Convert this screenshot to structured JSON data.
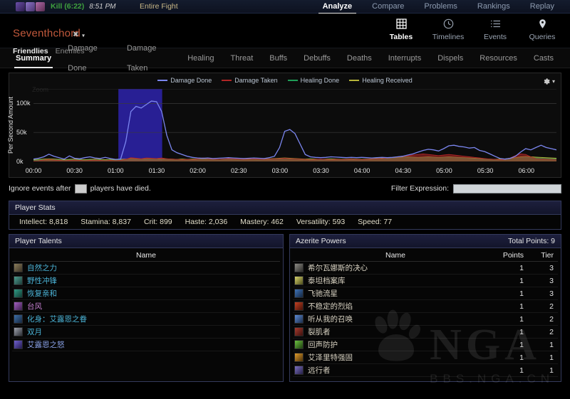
{
  "topbar": {
    "kill_label": "Kill (6:22)",
    "kill_time": "8:51 PM",
    "scope_label": "Entire Fight",
    "nav": [
      {
        "label": "Analyze",
        "selected": true
      },
      {
        "label": "Compare",
        "selected": false
      },
      {
        "label": "Problems",
        "selected": false
      },
      {
        "label": "Rankings",
        "selected": false
      },
      {
        "label": "Replay",
        "selected": false
      }
    ]
  },
  "player": {
    "name": "Seventhchord",
    "close_glyph": "✖",
    "caret_glyph": "▾",
    "friendlies_label": "Friendlies",
    "enemies_label": "Enemies"
  },
  "viewnav": [
    {
      "label": "Tables",
      "icon": "grid-icon",
      "selected": true
    },
    {
      "label": "Timelines",
      "icon": "clock-icon",
      "selected": false
    },
    {
      "label": "Events",
      "icon": "list-icon",
      "selected": false
    },
    {
      "label": "Queries",
      "icon": "pin-icon",
      "selected": false
    }
  ],
  "subtabs": [
    {
      "label": "Summary",
      "selected": true
    },
    {
      "label": "Damage Done",
      "selected": false
    },
    {
      "label": "Damage Taken",
      "selected": false
    },
    {
      "label": "Healing",
      "selected": false
    },
    {
      "label": "Threat",
      "selected": false
    },
    {
      "label": "Buffs",
      "selected": false
    },
    {
      "label": "Debuffs",
      "selected": false
    },
    {
      "label": "Deaths",
      "selected": false
    },
    {
      "label": "Interrupts",
      "selected": false
    },
    {
      "label": "Dispels",
      "selected": false
    },
    {
      "label": "Resources",
      "selected": false
    },
    {
      "label": "Casts",
      "selected": false
    }
  ],
  "chart_panel": {
    "zoom_label": "Zoom",
    "gear_icon": "gear-icon",
    "gear_caret": "▾"
  },
  "chart_data": {
    "type": "line",
    "title": "",
    "xlabel": "",
    "ylabel": "Per Second Amount",
    "ylim": [
      0,
      125000
    ],
    "yticks": [
      0,
      50000,
      100000
    ],
    "ytick_labels": [
      "0k",
      "50k",
      "100k"
    ],
    "grid": true,
    "legend_position": "top-center",
    "x": [
      "00:00",
      "00:30",
      "01:00",
      "01:30",
      "02:00",
      "02:30",
      "03:00",
      "03:30",
      "04:00",
      "04:30",
      "05:00",
      "05:30",
      "06:00"
    ],
    "x_range_seconds": [
      0,
      382
    ],
    "selection": {
      "start": "01:02",
      "end": "01:34",
      "color": "#2a219c"
    },
    "series": [
      {
        "name": "Damage Done",
        "color": "#7b86ef",
        "values": [
          4000,
          5500,
          8000,
          12500,
          9000,
          6500,
          4000,
          9500,
          5500,
          4500,
          6500,
          8000,
          6000,
          5000,
          7000,
          5000,
          3500,
          4000,
          34000,
          86000,
          95000,
          92000,
          98000,
          104000,
          103000,
          86000,
          45000,
          20000,
          15000,
          12000,
          9000,
          7000,
          6000,
          5500,
          6000,
          5000,
          5500,
          6000,
          6500,
          6000,
          5500,
          5000,
          5500,
          6000,
          5500,
          5000,
          6500,
          9000,
          24000,
          52000,
          55000,
          48000,
          30000,
          12000,
          8000,
          7000,
          6500,
          7000,
          8000,
          7500,
          7000,
          6500,
          7000,
          6500,
          7000,
          6500,
          6000,
          6500,
          7000,
          6500,
          7000,
          8000,
          9000,
          11000,
          13000,
          16000,
          19000,
          21000,
          20000,
          18000,
          22000,
          27000,
          28000,
          26000,
          25000,
          23000,
          24000,
          19000,
          17000,
          13000,
          9000,
          5000,
          4000,
          5500,
          9000,
          16000,
          22000,
          20000,
          24000,
          28000,
          24000,
          22000,
          20000
        ]
      },
      {
        "name": "Damage Taken",
        "color": "#b02626",
        "values": [
          1000,
          1500,
          2500,
          3500,
          2500,
          2000,
          1500,
          2000,
          2500,
          2000,
          1500,
          2000,
          2500,
          2000,
          1500,
          2000,
          1500,
          2000,
          3500,
          6500,
          5500,
          4500,
          6000,
          5500,
          5000,
          6000,
          4500,
          4000,
          3500,
          3000,
          3500,
          3000,
          4500,
          6000,
          5000,
          4000,
          3500,
          4000,
          5000,
          4500,
          4000,
          3500,
          4000,
          4500,
          4000,
          3500,
          4000,
          4500,
          5000,
          5500,
          5000,
          4500,
          4000,
          3500,
          3000,
          3500,
          4000,
          3500,
          3000,
          3500,
          3000,
          3500,
          4000,
          3500,
          3000,
          3500,
          4000,
          4500,
          5000,
          6000,
          7000,
          8000,
          9000,
          10000,
          11000,
          12000,
          13000,
          12000,
          11000,
          10000,
          11000,
          12000,
          11000,
          10000,
          9000,
          8000,
          7000,
          6000,
          5000,
          4000,
          3500,
          3000,
          3500,
          6000,
          10000,
          13000,
          12000,
          8000,
          5000,
          4500,
          4000,
          3500,
          3000
        ]
      },
      {
        "name": "Healing Done",
        "color": "#1f9e57",
        "values": [
          2000,
          2500,
          3000,
          3500,
          3000,
          2500,
          2000,
          2500,
          3000,
          2500,
          2000,
          2500,
          3000,
          2500,
          2000,
          2500,
          2000,
          2500,
          3000,
          4000,
          3500,
          3000,
          3500,
          4000,
          3500,
          3000,
          3500,
          3000,
          2500,
          3000,
          2500,
          3000,
          3500,
          4000,
          3500,
          3000,
          2500,
          3000,
          3500,
          3000,
          2500,
          3000,
          3500,
          3000,
          2500,
          3000,
          3500,
          4000,
          4500,
          5000,
          4500,
          4000,
          3500,
          3000,
          3500,
          3000,
          2500,
          3000,
          3500,
          3000,
          2500,
          3000,
          3500,
          3000,
          2500,
          3000,
          3500,
          4000,
          4500,
          5000,
          5500,
          6000,
          6500,
          7000,
          6500,
          6000,
          6500,
          7000,
          6500,
          6000,
          6500,
          7000,
          6500,
          6000,
          5500,
          5000,
          4500,
          4000,
          3500,
          3000,
          2500,
          3000,
          3500,
          4000,
          5000,
          6500,
          7000,
          6500,
          6000,
          5500,
          5000,
          4500,
          4000
        ]
      },
      {
        "name": "Healing Received",
        "color": "#b7b53a",
        "values": [
          3000,
          3500,
          4000,
          4500,
          4000,
          3500,
          3000,
          3500,
          4000,
          3500,
          3000,
          3500,
          4000,
          3500,
          3000,
          3500,
          3000,
          3500,
          4000,
          5000,
          4500,
          4000,
          4500,
          5000,
          4500,
          4000,
          4500,
          4000,
          3500,
          4000,
          3500,
          4000,
          4500,
          5000,
          4500,
          4000,
          3500,
          4000,
          4500,
          4000,
          3500,
          4000,
          4500,
          4000,
          3500,
          4000,
          4500,
          5000,
          5500,
          6000,
          5500,
          5000,
          4500,
          4000,
          4500,
          4000,
          3500,
          4000,
          4500,
          4000,
          3500,
          4000,
          4500,
          4000,
          3500,
          4000,
          4500,
          5000,
          5500,
          6000,
          6500,
          7000,
          7500,
          8000,
          7500,
          7000,
          7500,
          8000,
          7500,
          7000,
          7500,
          8000,
          7500,
          7000,
          6500,
          6000,
          5500,
          5000,
          4500,
          4000,
          3500,
          4000,
          4500,
          5500,
          6500,
          8000,
          8500,
          8000,
          7500,
          7000,
          6500,
          6000,
          5500
        ]
      }
    ]
  },
  "ignore_row": {
    "prefix": "Ignore events after",
    "value": "",
    "suffix": "players have died.",
    "filter_label": "Filter Expression:",
    "filter_value": "",
    "filter_placeholder": ""
  },
  "player_stats": {
    "title": "Player Stats",
    "stats": [
      "Intellect: 8,818",
      "Stamina: 8,837",
      "Crit: 899",
      "Haste: 2,036",
      "Mastery: 462",
      "Versatility: 593",
      "Speed: 77"
    ]
  },
  "player_talents": {
    "title": "Player Talents",
    "column_name": "Name",
    "rows": [
      {
        "name": "自然之力",
        "color": "#4bb3d6",
        "icon_a": "#8b7d5a",
        "icon_b": "#3a3226"
      },
      {
        "name": "野性冲锋",
        "color": "#4bb3d6",
        "icon_a": "#4e9e8e",
        "icon_b": "#1d3b38"
      },
      {
        "name": "恢复亲和",
        "color": "#4bb3d6",
        "icon_a": "#2f9d86",
        "icon_b": "#123a32"
      },
      {
        "name": "台风",
        "color": "#c47fd0",
        "icon_a": "#a35fc1",
        "icon_b": "#3c1f4c"
      },
      {
        "name": "化身：艾露恩之眷",
        "color": "#4bb3d6",
        "icon_a": "#3d6fa8",
        "icon_b": "#16263c"
      },
      {
        "name": "双月",
        "color": "#4bb3d6",
        "icon_a": "#9fa3ad",
        "icon_b": "#2a2d33"
      },
      {
        "name": "艾露恩之怒",
        "color": "#8aa2e8",
        "icon_a": "#6f5fd0",
        "icon_b": "#241c4e"
      }
    ]
  },
  "azerite_powers": {
    "title": "Azerite Powers",
    "total_points_label": "Total Points: 9",
    "columns": [
      "Name",
      "Points",
      "Tier"
    ],
    "rows": [
      {
        "name": "希尔瓦娜斯的决心",
        "points": "1",
        "tier": "3",
        "color": "#d6d0c0",
        "icon_a": "#8d8b85",
        "icon_b": "#2c2b28"
      },
      {
        "name": "泰坦档案库",
        "points": "1",
        "tier": "3",
        "color": "#d6d0c0",
        "icon_a": "#d8d46a",
        "icon_b": "#4a4a1c"
      },
      {
        "name": "飞驰流星",
        "points": "1",
        "tier": "3",
        "color": "#d6d0c0",
        "icon_a": "#3f73b8",
        "icon_b": "#14263f"
      },
      {
        "name": "不稳定的烈焰",
        "points": "1",
        "tier": "2",
        "color": "#d6d0c0",
        "icon_a": "#c44022",
        "icon_b": "#431208"
      },
      {
        "name": "听从我的召唤",
        "points": "1",
        "tier": "2",
        "color": "#d6d0c0",
        "icon_a": "#5c8bd6",
        "icon_b": "#1b2c47"
      },
      {
        "name": "裂肌者",
        "points": "1",
        "tier": "2",
        "color": "#d6d0c0",
        "icon_a": "#a83a2e",
        "icon_b": "#3a110d"
      },
      {
        "name": "回声防护",
        "points": "1",
        "tier": "1",
        "color": "#d6d0c0",
        "icon_a": "#6cc23f",
        "icon_b": "#1e3d12"
      },
      {
        "name": "艾泽里特强固",
        "points": "1",
        "tier": "1",
        "color": "#d6d0c0",
        "icon_a": "#e09b2a",
        "icon_b": "#4a300a"
      },
      {
        "name": "远行者",
        "points": "1",
        "tier": "1",
        "color": "#d6d0c0",
        "icon_a": "#7a6fc0",
        "icon_b": "#251f45"
      }
    ]
  },
  "watermark": {
    "big_text": "NGA",
    "small_text": "BBS.NGA.CN"
  }
}
